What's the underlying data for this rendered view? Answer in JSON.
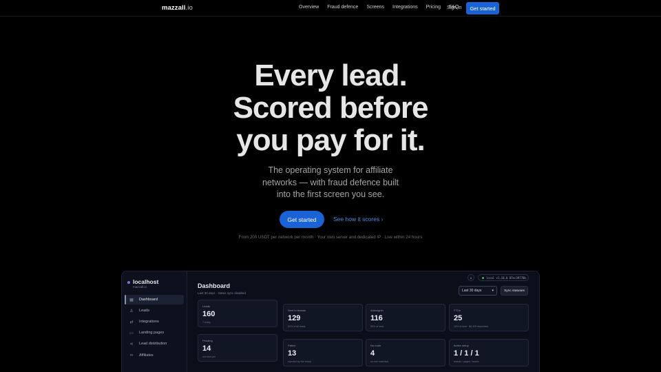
{
  "nav": {
    "logo_name": "mazzall",
    "logo_tld": ".io",
    "links": [
      "Overview",
      "Fraud defence",
      "Screens",
      "Integrations",
      "Pricing",
      "FAQ"
    ],
    "signin": "Sign in",
    "cta": "Get started"
  },
  "hero": {
    "title_line1": "Every lead.",
    "title_line2": "Scored before",
    "title_line3": "you pay for it.",
    "subtitle": "The operating system for affiliate networks — with fraud defence built into the first screen you see.",
    "primary_cta": "Get started",
    "secondary_cta": "See how it scores ›",
    "fineprint": "From 200 USDT per network per month · Your own server and dedicated IP · Live within 24 hours"
  },
  "dashboard": {
    "brand": "localhost",
    "brand_host": "mazzall.io",
    "sidebar": [
      {
        "label": "Dashboard",
        "icon": "grid-icon",
        "glyph": "▦",
        "active": true
      },
      {
        "label": "Leads",
        "icon": "user-icon",
        "glyph": "♙",
        "active": false
      },
      {
        "label": "Integrations",
        "icon": "arrows-icon",
        "glyph": "⇄",
        "active": false
      },
      {
        "label": "Landing pages",
        "icon": "page-icon",
        "glyph": "▭",
        "active": false
      },
      {
        "label": "Lead distribution",
        "icon": "share-icon",
        "glyph": "⋖",
        "active": false
      },
      {
        "label": "Affiliates",
        "icon": "link-icon",
        "glyph": "∞",
        "active": false
      }
    ],
    "title": "Dashboard",
    "subtitle": "Last 30 days · status sync disabled",
    "version_icon": "a",
    "version": "local v1.10.0 07ec39770b",
    "range": "Last 30 days",
    "range_caret": "▾",
    "sync_button": "Sync statuses",
    "cards": [
      {
        "label": "Leads",
        "value": "160",
        "sub": "7 today"
      },
      {
        "label": "Sent to brands",
        "value": "129",
        "sub": "81% of all leads"
      },
      {
        "label": "Autosignin",
        "value": "116",
        "sub": "90% of sent"
      },
      {
        "label": "FTDs",
        "value": "25",
        "sub": "19% of sent · $5,325 deposited"
      },
      {
        "label": "Pending",
        "value": "14",
        "sub": "not sent yet"
      },
      {
        "label": "Failed",
        "value": "13",
        "sub": "rejected by the brand"
      },
      {
        "label": "No route",
        "value": "4",
        "sub": "no rule matched"
      },
      {
        "label": "Active setup",
        "value": "1 / 1 / 1",
        "sub": "brands / pages / boxes"
      }
    ]
  }
}
